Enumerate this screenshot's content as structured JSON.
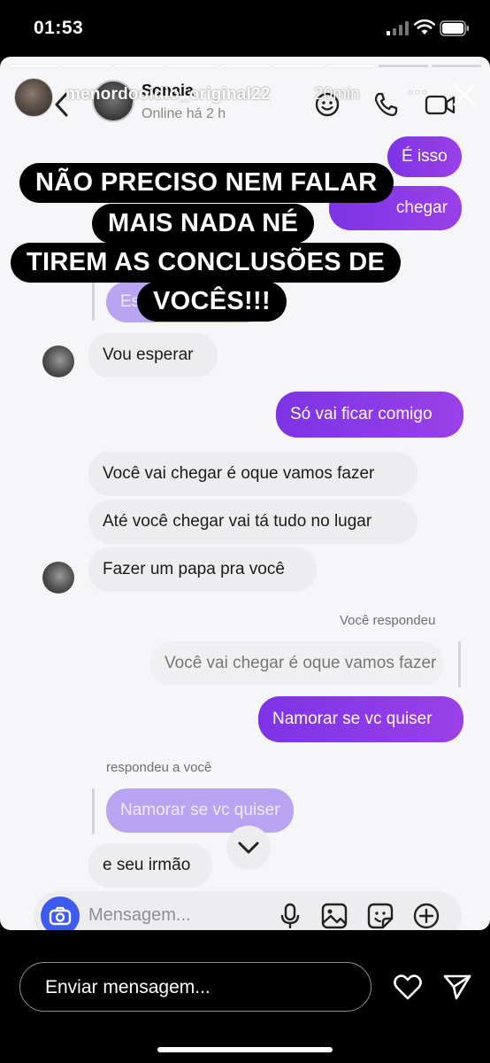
{
  "status_bar": {
    "time": "01:53"
  },
  "story": {
    "username": "menordooidio_original22",
    "time_ago": "20min",
    "more_label": "···"
  },
  "chat": {
    "contact_name": "Sonaia",
    "online_status": "Online há 2 h"
  },
  "caption": {
    "lines": [
      "NÃO PRECISO NEM FALAR",
      "MAIS NADA NÉ",
      "TIREM AS CONCLUSÕES DE",
      "VOCÊS!!!"
    ]
  },
  "messages": {
    "m1": "É isso",
    "m2_partial": "chegar",
    "m3_partial": "Es",
    "m4": "Vou esperar",
    "m5": "Só vai ficar comigo",
    "m6": "Você vai chegar é oque vamos fazer",
    "m7": "Até você chegar vai tá tudo no lugar",
    "m8": "Fazer um papa pra você",
    "you_replied_label": "Você respondeu",
    "quoted_1": "Você vai chegar é oque vamos fazer",
    "m9": "Namorar se vc quiser",
    "replied_to_you_label": "respondeu a você",
    "quoted_2": "Namorar se vc quiser",
    "m10": "e seu irmão"
  },
  "composer": {
    "placeholder": "Mensagem..."
  },
  "bottom_bar": {
    "reply_placeholder": "Enviar mensagem..."
  },
  "colors": {
    "outgoing_bubble": "#8a3ae8",
    "incoming_bubble": "#ededf0",
    "camera_button": "#3d5af1"
  },
  "icons": [
    "signal-icon",
    "wifi-icon",
    "battery-icon",
    "close-icon",
    "back-chevron-icon",
    "emoji-icon",
    "phone-icon",
    "video-icon",
    "chevron-down-icon",
    "camera-icon",
    "mic-icon",
    "gallery-icon",
    "sticker-icon",
    "plus-icon",
    "heart-icon",
    "send-icon"
  ]
}
